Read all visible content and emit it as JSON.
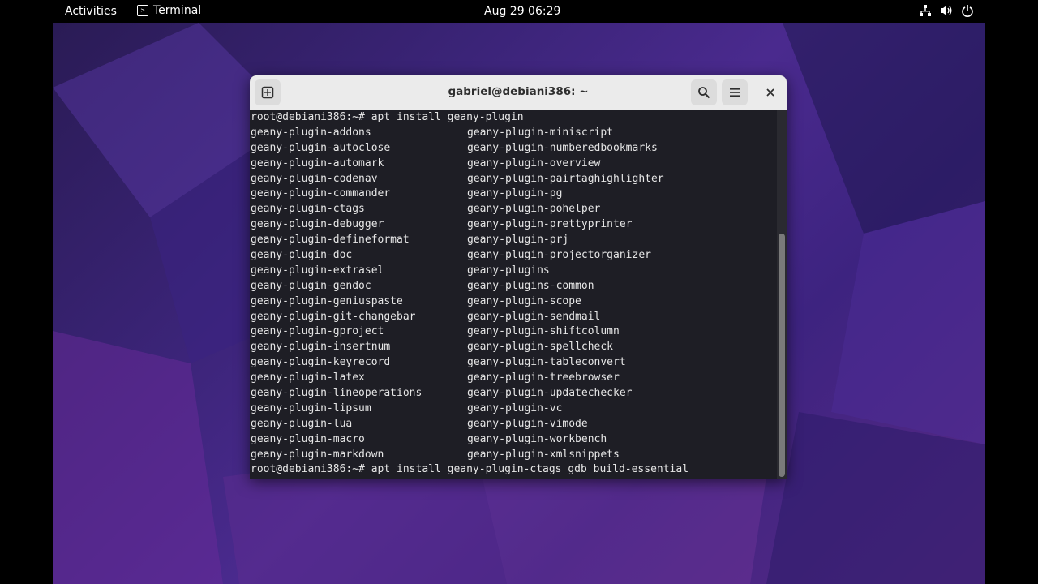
{
  "topbar": {
    "activities": "Activities",
    "app_name": "Terminal",
    "clock": "Aug 29  06:29"
  },
  "icons": {
    "network": "network-icon",
    "volume": "volume-icon",
    "power": "power-icon"
  },
  "window": {
    "title": "gabriel@debiani386: ~"
  },
  "terminal": {
    "prompt1": "root@debiani386:~# apt install geany-plugin",
    "rows": [
      [
        "geany-plugin-addons",
        "geany-plugin-miniscript"
      ],
      [
        "geany-plugin-autoclose",
        "geany-plugin-numberedbookmarks"
      ],
      [
        "geany-plugin-automark",
        "geany-plugin-overview"
      ],
      [
        "geany-plugin-codenav",
        "geany-plugin-pairtaghighlighter"
      ],
      [
        "geany-plugin-commander",
        "geany-plugin-pg"
      ],
      [
        "geany-plugin-ctags",
        "geany-plugin-pohelper"
      ],
      [
        "geany-plugin-debugger",
        "geany-plugin-prettyprinter"
      ],
      [
        "geany-plugin-defineformat",
        "geany-plugin-prj"
      ],
      [
        "geany-plugin-doc",
        "geany-plugin-projectorganizer"
      ],
      [
        "geany-plugin-extrasel",
        "geany-plugins"
      ],
      [
        "geany-plugin-gendoc",
        "geany-plugins-common"
      ],
      [
        "geany-plugin-geniuspaste",
        "geany-plugin-scope"
      ],
      [
        "geany-plugin-git-changebar",
        "geany-plugin-sendmail"
      ],
      [
        "geany-plugin-gproject",
        "geany-plugin-shiftcolumn"
      ],
      [
        "geany-plugin-insertnum",
        "geany-plugin-spellcheck"
      ],
      [
        "geany-plugin-keyrecord",
        "geany-plugin-tableconvert"
      ],
      [
        "geany-plugin-latex",
        "geany-plugin-treebrowser"
      ],
      [
        "geany-plugin-lineoperations",
        "geany-plugin-updatechecker"
      ],
      [
        "geany-plugin-lipsum",
        "geany-plugin-vc"
      ],
      [
        "geany-plugin-lua",
        "geany-plugin-vimode"
      ],
      [
        "geany-plugin-macro",
        "geany-plugin-workbench"
      ],
      [
        "geany-plugin-markdown",
        "geany-plugin-xmlsnippets"
      ]
    ],
    "prompt2": "root@debiani386:~# apt install geany-plugin-ctags gdb build-essential"
  }
}
